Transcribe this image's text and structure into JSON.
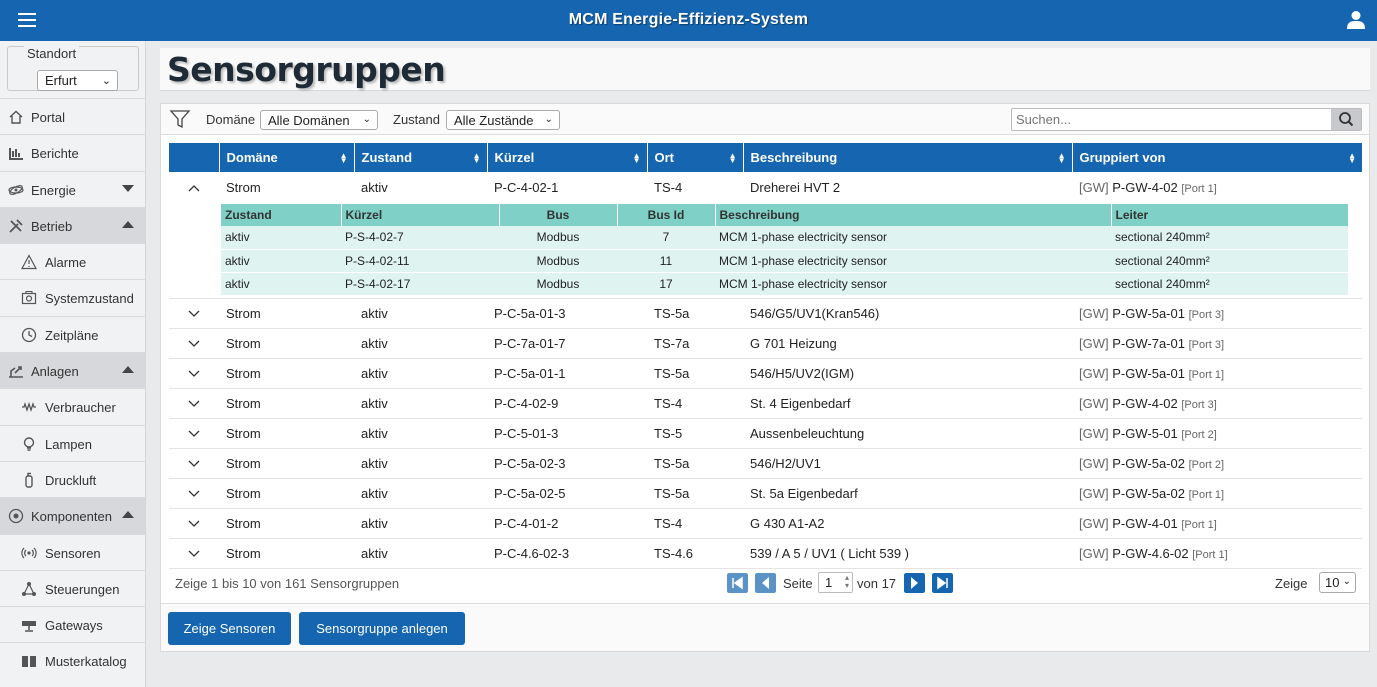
{
  "app": {
    "title": "MCM Energie-Effizienz-System"
  },
  "standort": {
    "legend": "Standort",
    "value": "Erfurt"
  },
  "nav": [
    {
      "label": "Portal",
      "icon": "home-icon"
    },
    {
      "label": "Berichte",
      "icon": "bar-chart-icon"
    },
    {
      "label": "Energie",
      "icon": "atom-icon"
    },
    {
      "label": "Betrieb",
      "icon": "tools-icon"
    },
    {
      "label": "Alarme",
      "icon": "warning-icon"
    },
    {
      "label": "Systemzustand",
      "icon": "system-icon"
    },
    {
      "label": "Zeitpläne",
      "icon": "clock-icon"
    },
    {
      "label": "Anlagen",
      "icon": "plant-icon"
    },
    {
      "label": "Verbraucher",
      "icon": "wave-icon"
    },
    {
      "label": "Lampen",
      "icon": "lamp-icon"
    },
    {
      "label": "Druckluft",
      "icon": "gas-cylinder-icon"
    },
    {
      "label": "Komponenten",
      "icon": "components-icon"
    },
    {
      "label": "Sensoren",
      "icon": "sensor-icon"
    },
    {
      "label": "Steuerungen",
      "icon": "network-icon"
    },
    {
      "label": "Gateways",
      "icon": "gateway-icon"
    },
    {
      "label": "Musterkatalog",
      "icon": "book-icon"
    }
  ],
  "page": {
    "title": "Sensorgruppen"
  },
  "filter": {
    "domain_label": "Domäne",
    "domain_value": "Alle Domänen",
    "state_label": "Zustand",
    "state_value": "Alle Zustände",
    "search_placeholder": "Suchen..."
  },
  "columns": [
    "Domäne",
    "Zustand",
    "Kürzel",
    "Ort",
    "Beschreibung",
    "Gruppiert von"
  ],
  "rows": [
    {
      "domain": "Strom",
      "state": "aktiv",
      "code": "P-C-4-02-1",
      "ort": "TS-4",
      "desc": "Dreherei HVT 2",
      "gw": "[GW]",
      "group": "P-GW-4-02",
      "port": "[Port 1]"
    },
    {
      "domain": "Strom",
      "state": "aktiv",
      "code": "P-C-5a-01-3",
      "ort": "TS-5a",
      "desc": "546/G5/UV1(Kran546)",
      "gw": "[GW]",
      "group": "P-GW-5a-01",
      "port": "[Port 3]"
    },
    {
      "domain": "Strom",
      "state": "aktiv",
      "code": "P-C-7a-01-7",
      "ort": "TS-7a",
      "desc": "G 701 Heizung",
      "gw": "[GW]",
      "group": "P-GW-7a-01",
      "port": "[Port 3]"
    },
    {
      "domain": "Strom",
      "state": "aktiv",
      "code": "P-C-5a-01-1",
      "ort": "TS-5a",
      "desc": "546/H5/UV2(IGM)",
      "gw": "[GW]",
      "group": "P-GW-5a-01",
      "port": "[Port 1]"
    },
    {
      "domain": "Strom",
      "state": "aktiv",
      "code": "P-C-4-02-9",
      "ort": "TS-4",
      "desc": "St. 4 Eigenbedarf",
      "gw": "[GW]",
      "group": "P-GW-4-02",
      "port": "[Port 3]"
    },
    {
      "domain": "Strom",
      "state": "aktiv",
      "code": "P-C-5-01-3",
      "ort": "TS-5",
      "desc": "Aussenbeleuchtung",
      "gw": "[GW]",
      "group": "P-GW-5-01",
      "port": "[Port 2]"
    },
    {
      "domain": "Strom",
      "state": "aktiv",
      "code": "P-C-5a-02-3",
      "ort": "TS-5a",
      "desc": "546/H2/UV1",
      "gw": "[GW]",
      "group": "P-GW-5a-02",
      "port": "[Port 2]"
    },
    {
      "domain": "Strom",
      "state": "aktiv",
      "code": "P-C-5a-02-5",
      "ort": "TS-5a",
      "desc": "St. 5a Eigenbedarf",
      "gw": "[GW]",
      "group": "P-GW-5a-02",
      "port": "[Port 1]"
    },
    {
      "domain": "Strom",
      "state": "aktiv",
      "code": "P-C-4-01-2",
      "ort": "TS-4",
      "desc": "G 430 A1-A2",
      "gw": "[GW]",
      "group": "P-GW-4-01",
      "port": "[Port 1]"
    },
    {
      "domain": "Strom",
      "state": "aktiv",
      "code": "P-C-4.6-02-3",
      "ort": "TS-4.6",
      "desc": "539 / A 5 / UV1 ( Licht 539 )",
      "gw": "[GW]",
      "group": "P-GW-4.6-02",
      "port": "[Port 1]"
    }
  ],
  "subtable": {
    "columns": [
      "Zustand",
      "Kürzel",
      "Bus",
      "Bus Id",
      "Beschreibung",
      "Leiter"
    ],
    "rows": [
      {
        "state": "aktiv",
        "code": "P-S-4-02-7",
        "bus": "Modbus",
        "busid": "7",
        "desc": "MCM 1-phase electricity sensor",
        "leiter": "sectional 240mm²"
      },
      {
        "state": "aktiv",
        "code": "P-S-4-02-11",
        "bus": "Modbus",
        "busid": "11",
        "desc": "MCM 1-phase electricity sensor",
        "leiter": "sectional 240mm²"
      },
      {
        "state": "aktiv",
        "code": "P-S-4-02-17",
        "bus": "Modbus",
        "busid": "17",
        "desc": "MCM 1-phase electricity sensor",
        "leiter": "sectional 240mm²"
      }
    ]
  },
  "pager": {
    "info": "Zeige 1 bis 10 von 161 Sensorgruppen",
    "page_label": "Seite",
    "page_value": "1",
    "of_label": "von 17",
    "show_label": "Zeige",
    "show_value": "10"
  },
  "buttons": {
    "show_sensors": "Zeige Sensoren",
    "create_group": "Sensorgruppe anlegen"
  },
  "colors": {
    "primary": "#1565b0",
    "subheader": "#7fd0c7",
    "subrow": "#dff4f1",
    "pager_btn": "#5b93c7"
  }
}
